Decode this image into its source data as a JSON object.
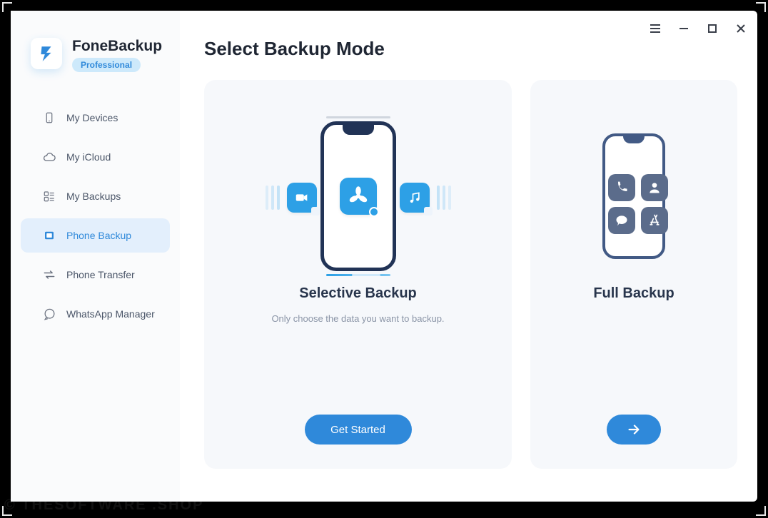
{
  "brand": {
    "name": "FoneBackup",
    "badge": "Professional"
  },
  "sidebar": {
    "items": [
      {
        "label": "My Devices",
        "icon": "device-icon"
      },
      {
        "label": "My iCloud",
        "icon": "cloud-icon"
      },
      {
        "label": "My Backups",
        "icon": "backups-icon"
      },
      {
        "label": "Phone Backup",
        "icon": "phone-backup-icon",
        "active": true
      },
      {
        "label": "Phone Transfer",
        "icon": "transfer-icon"
      },
      {
        "label": "WhatsApp Manager",
        "icon": "whatsapp-icon"
      }
    ]
  },
  "page": {
    "title": "Select Backup Mode"
  },
  "cards": {
    "selective": {
      "title": "Selective Backup",
      "description": "Only choose the data you want to backup.",
      "button": "Get Started"
    },
    "full": {
      "title": "Full Backup"
    }
  },
  "watermark": "© THESOFTWARE .SHOP"
}
